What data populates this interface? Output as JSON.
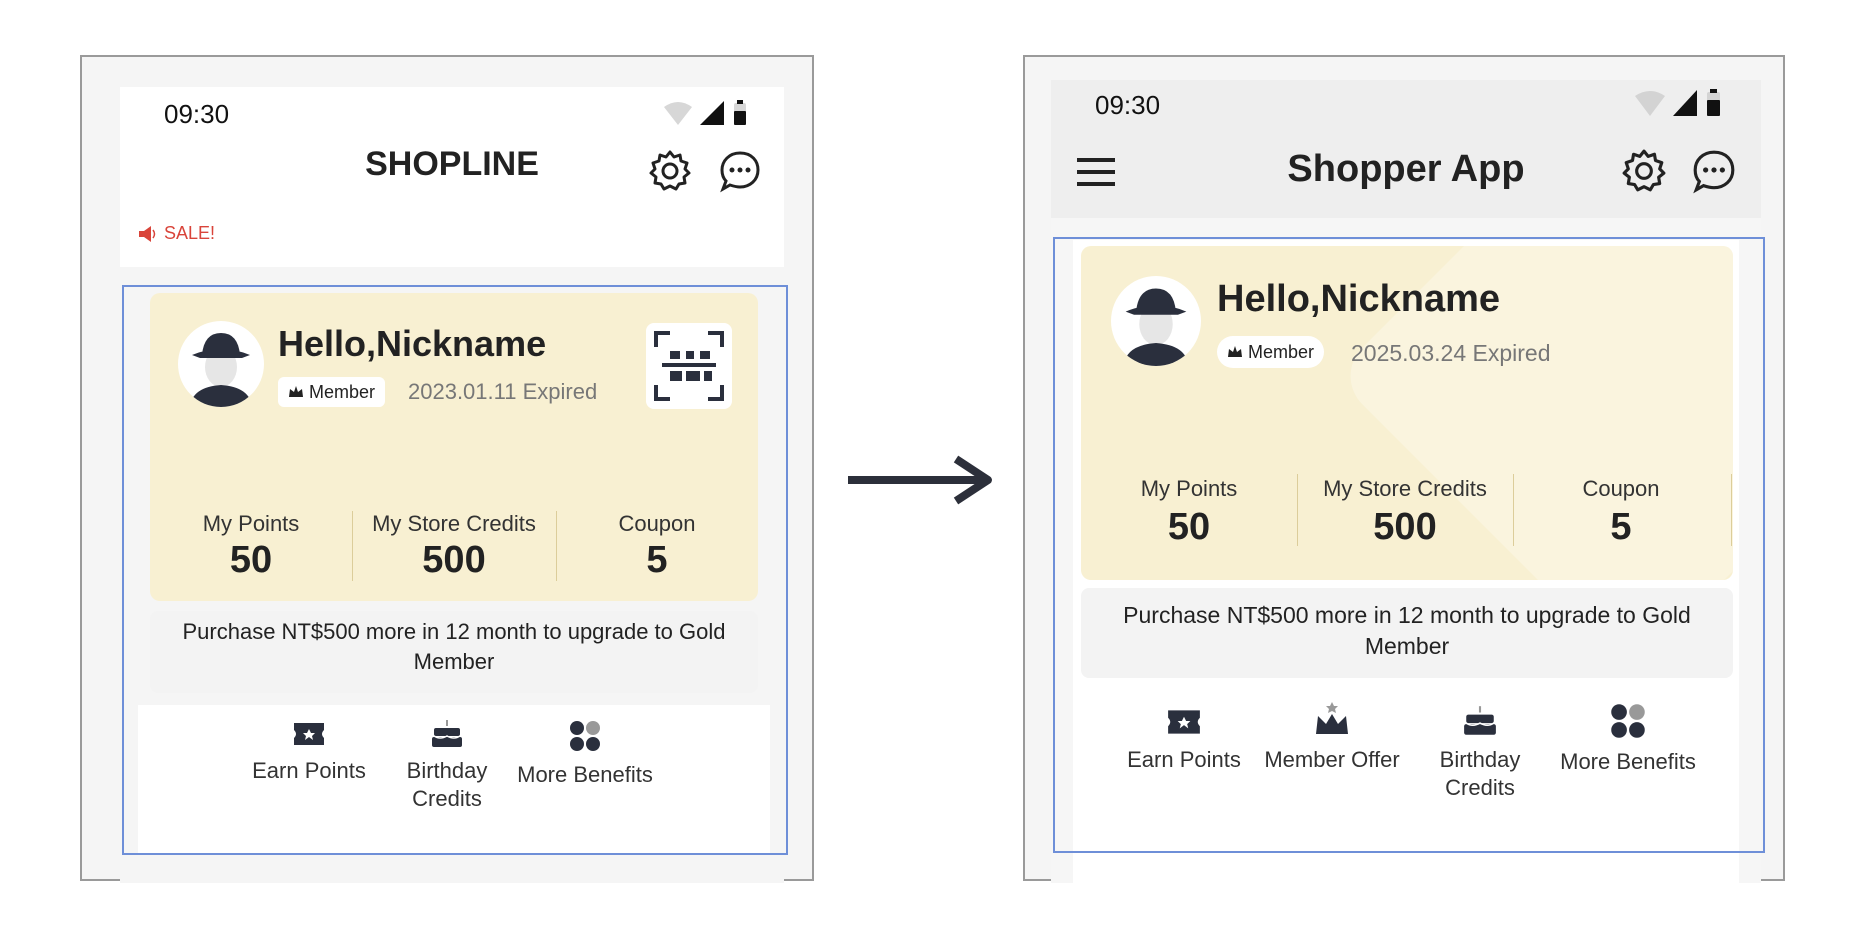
{
  "before": {
    "status_time": "09:30",
    "app_title": "SHOPLINE",
    "announcement": "SALE!",
    "greeting": "Hello,Nickname",
    "member_badge": "Member",
    "expiry": "2023.01.11 Expired",
    "stats": [
      {
        "label": "My Points",
        "value": "50"
      },
      {
        "label": "My Store Credits",
        "value": "500"
      },
      {
        "label": "Coupon",
        "value": "5"
      }
    ],
    "upgrade_text": "Purchase NT$500 more in 12 month to upgrade to Gold Member",
    "benefits": [
      {
        "label": "Earn Points",
        "icon": "ticket-icon"
      },
      {
        "label": "Birthday Credits",
        "icon": "cake-icon"
      },
      {
        "label": "More Benefits",
        "icon": "grid-icon"
      }
    ]
  },
  "after": {
    "status_time": "09:30",
    "app_title": "Shopper App",
    "greeting": "Hello,Nickname",
    "member_badge": "Member",
    "expiry": "2025.03.24 Expired",
    "stats": [
      {
        "label": "My Points",
        "value": "50"
      },
      {
        "label": "My Store Credits",
        "value": "500"
      },
      {
        "label": "Coupon",
        "value": "5"
      }
    ],
    "upgrade_text": "Purchase NT$500 more in 12 month to upgrade to Gold Member",
    "benefits": [
      {
        "label": "Earn Points",
        "icon": "ticket-icon"
      },
      {
        "label": "Member Offer",
        "icon": "crown-icon"
      },
      {
        "label": "Birthday Credits",
        "icon": "cake-icon"
      },
      {
        "label": "More Benefits",
        "icon": "grid-icon"
      }
    ]
  },
  "colors": {
    "card_bg": "#f8f0d2",
    "highlight_border": "#6e8fd8",
    "sale_red": "#d9443a",
    "header_gray": "#eeeeee"
  }
}
